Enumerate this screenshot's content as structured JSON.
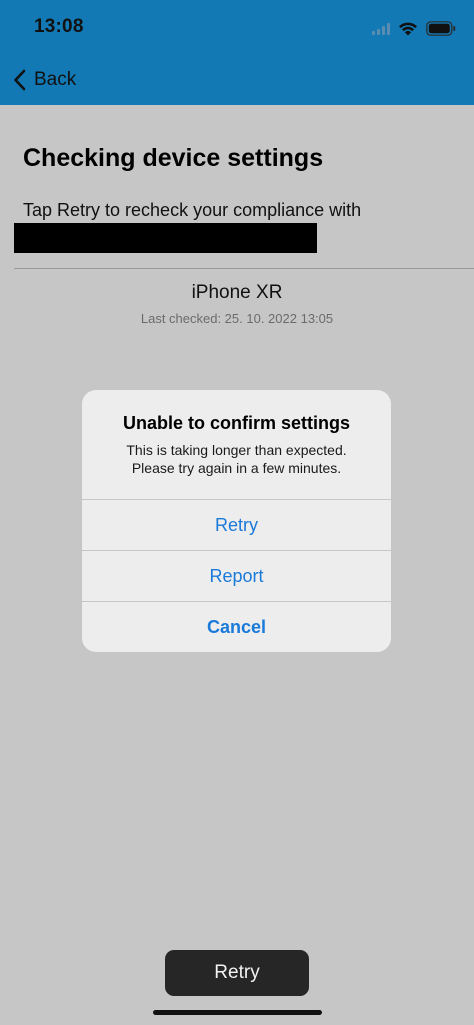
{
  "status_bar": {
    "time": "13:08",
    "icons": [
      "cellular-signal-icon",
      "wifi-icon",
      "battery-icon"
    ]
  },
  "nav": {
    "back_label": "Back",
    "back_icon": "chevron-left-icon"
  },
  "page": {
    "title": "Checking device settings",
    "description": "Tap Retry to recheck your compliance with",
    "device_name": "iPhone XR",
    "last_checked": "Last checked: 25. 10. 2022 13:05"
  },
  "alert": {
    "title": "Unable to confirm settings",
    "message_line1": "This is taking longer than expected.",
    "message_line2": "Please try again in a few minutes.",
    "buttons": [
      {
        "label": "Retry"
      },
      {
        "label": "Report"
      },
      {
        "label": "Cancel"
      }
    ]
  },
  "footer": {
    "retry_label": "Retry"
  },
  "colors": {
    "header": "#1279b4",
    "background": "#c6c6c6",
    "alert_button_text": "#1a7ad9",
    "retry_button": "#262626"
  }
}
